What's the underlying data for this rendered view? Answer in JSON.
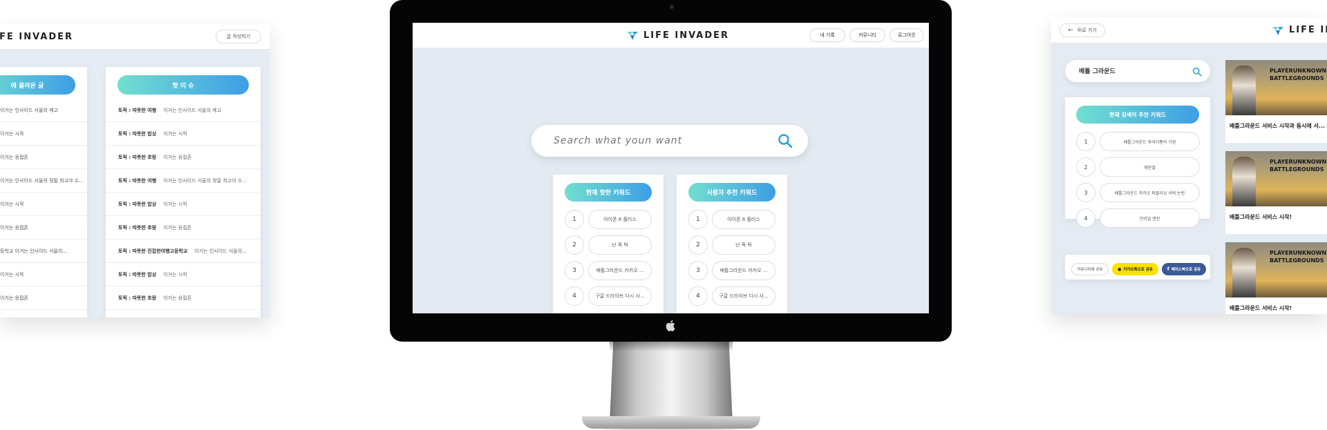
{
  "brand": "LIFE INVADER",
  "left_panel": {
    "write_button": "글 작성하기",
    "col1_header": "에 올라온 글",
    "col2_header": "핫 이 슈",
    "col1_rows": [
      "이거는 인사이드 서울의 제고",
      "이거는 시작",
      "이거는 응접존",
      "이거는 인사이드 서울의 정말 최고야 수...",
      "이거는 시작",
      "이거는 응접존",
      "등학교    이거는 인사이드 서울의...",
      "이거는 시작",
      "이거는 응접존"
    ],
    "col2_rows": [
      {
        "topic": "토픽 : 따뜻한 여행",
        "title": "이거는 인사이드 서울의 제고"
      },
      {
        "topic": "토픽 : 따뜻한 밥상",
        "title": "이거는 시작"
      },
      {
        "topic": "토픽 : 따뜻한 호랑",
        "title": "이거는 응접존"
      },
      {
        "topic": "토픽 : 따뜻한 여행",
        "title": "이거는 인사이드 서울의 정말 최고야 수..."
      },
      {
        "topic": "토픽 : 따뜻한 밥상",
        "title": "이거는 시작"
      },
      {
        "topic": "토픽 : 따뜻한 호랑",
        "title": "이거는 응접존"
      },
      {
        "topic": "토픽 : 따뜻한 진잡한여행고등학교",
        "title": "이거는 인사이드 서울의..."
      },
      {
        "topic": "토픽 : 따뜻한 밥상",
        "title": "이거는 시작"
      },
      {
        "topic": "토픽 : 따뜻한 호랑",
        "title": "이거는 응접존"
      }
    ]
  },
  "monitor": {
    "nav": {
      "my_record": "내 기록",
      "community": "커뮤니티",
      "logout": "로그아웃"
    },
    "search_placeholder": "Search what youn want",
    "card1": {
      "header": "현재 핫한 키워드",
      "items": [
        {
          "num": "1",
          "text": "아이폰 8 플러스"
        },
        {
          "num": "2",
          "text": "난 죽 턱"
        },
        {
          "num": "3",
          "text": "배틀그라운드 카카오 ..."
        },
        {
          "num": "4",
          "text": "구글 드라이브 다시 사..."
        }
      ]
    },
    "card2": {
      "header": "사용자 추천 키워드",
      "items": [
        {
          "num": "1",
          "text": "아이폰 8 플러스"
        },
        {
          "num": "2",
          "text": "난 죽 턱"
        },
        {
          "num": "3",
          "text": "배틀그라운드 카카오 ..."
        },
        {
          "num": "4",
          "text": "구글 드라이브 다시 사..."
        }
      ]
    }
  },
  "right_panel": {
    "back_button": "뒤로 가기",
    "brand_partial": "LIFE IN",
    "search_value": "배틀 그라운드",
    "rec_header": "현재 검색어 추천 키워드",
    "rec_items": [
      {
        "num": "1",
        "text": "배틀그라운드 후라이팬의 기원"
      },
      {
        "num": "2",
        "text": "에란겔"
      },
      {
        "num": "3",
        "text": "배틀그라운드 카카오 퍼블리싱 서버 논란"
      },
      {
        "num": "4",
        "text": "언리얼 엔진"
      }
    ],
    "share": {
      "community": "커뮤니티에 공유",
      "kakao": "카카오톡으로 공유",
      "facebook": "페이스북으로 공유"
    },
    "games": [
      {
        "title": "배틀그라운드 서비스 시작과 동시에 서...",
        "image_text": "PLAYERUNKNOWN'S BATTLEGROUNDS"
      },
      {
        "title": "배틀그라운드 서비스 시작!",
        "image_text": "PLAYERUNKNOWN'S BATTLEGROUNDS"
      },
      {
        "title": "배틀그라운드 서비스 시작!",
        "image_text": "PLAYERUNKNOWN'S BATTLEGROUNDS"
      }
    ]
  },
  "colors": {
    "gradient_start": "#72dfcf",
    "gradient_end": "#3d9ee6",
    "kakao": "#fae100",
    "facebook": "#3b5998",
    "search_icon": "#29a3c9"
  },
  "icons": [
    "logo-icon",
    "search-icon",
    "apple-icon",
    "back-arrow-icon",
    "kakao-icon",
    "facebook-icon"
  ]
}
